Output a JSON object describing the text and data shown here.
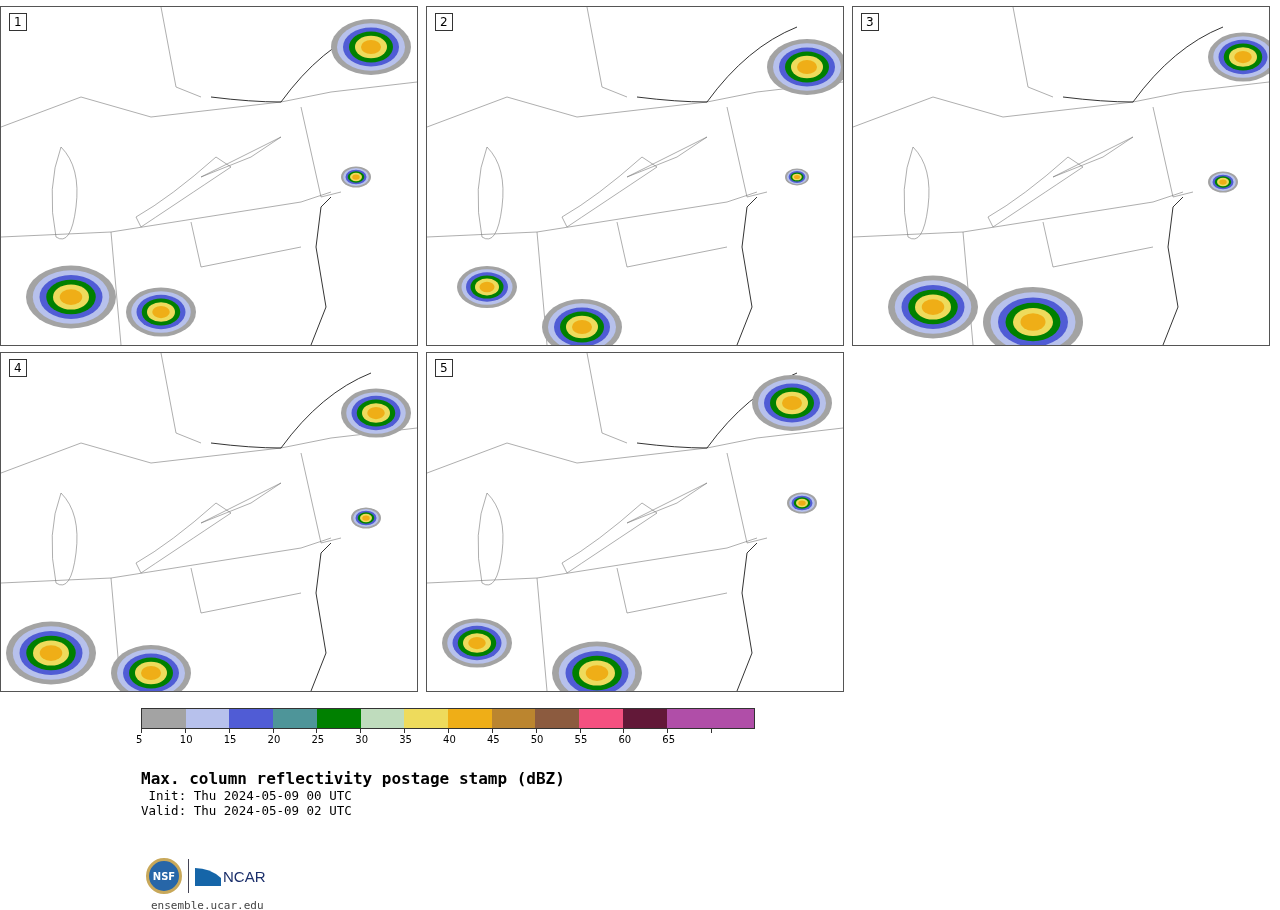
{
  "panels": [
    {
      "label": "1"
    },
    {
      "label": "2"
    },
    {
      "label": "3"
    },
    {
      "label": "4"
    },
    {
      "label": "5"
    }
  ],
  "colorbar": {
    "segments": [
      {
        "color": "#a3a3a3",
        "label": "5"
      },
      {
        "color": "#b7c1ec",
        "label": "10"
      },
      {
        "color": "#505cd5",
        "label": "15"
      },
      {
        "color": "#4e9599",
        "label": "20"
      },
      {
        "color": "#008000",
        "label": "25"
      },
      {
        "color": "#bfdcbd",
        "label": "30"
      },
      {
        "color": "#eedb5c",
        "label": "35"
      },
      {
        "color": "#efae17",
        "label": "40"
      },
      {
        "color": "#bb852f",
        "label": "45"
      },
      {
        "color": "#8c5b3f",
        "label": "50"
      },
      {
        "color": "#f45080",
        "label": "55"
      },
      {
        "color": "#621838",
        "label": "60"
      },
      {
        "color": "#b04ea8",
        "label": "65"
      },
      {
        "color": "#b04ea8"
      }
    ]
  },
  "title": "Max. column reflectivity postage stamp (dBZ)",
  "init": " Init: Thu 2024-05-09 00 UTC",
  "valid": "Valid: Thu 2024-05-09 02 UTC",
  "logo": {
    "seal_text": "NSF",
    "wordmark": "NCAR"
  },
  "link": "ensemble.ucar.edu"
}
